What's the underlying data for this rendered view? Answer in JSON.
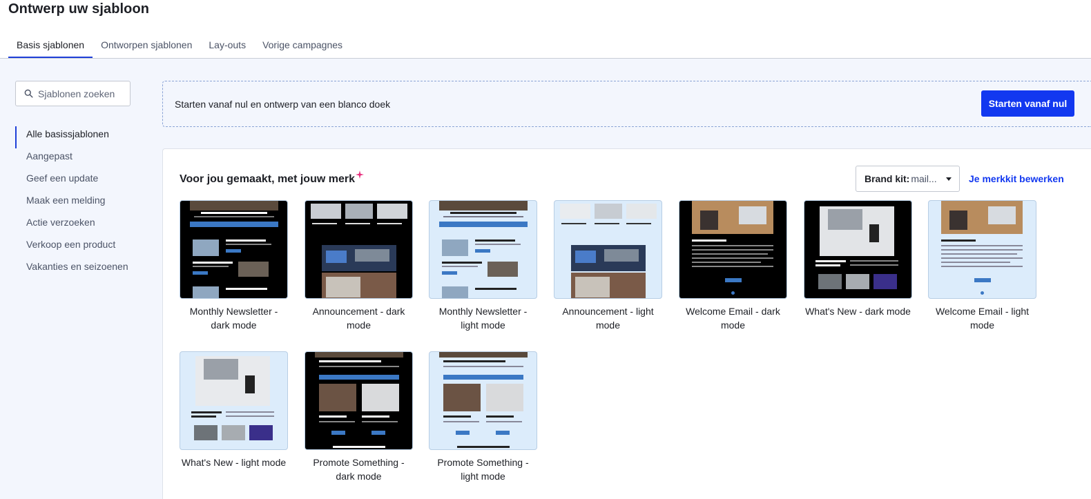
{
  "page": {
    "title": "Ontwerp uw sjabloon"
  },
  "tabs": [
    {
      "label": "Basis sjablonen",
      "active": true
    },
    {
      "label": "Ontworpen sjablonen",
      "active": false
    },
    {
      "label": "Lay-outs",
      "active": false
    },
    {
      "label": "Vorige campagnes",
      "active": false
    }
  ],
  "sidebar": {
    "search_placeholder": "Sjablonen zoeken",
    "categories": [
      {
        "label": "Alle basissjablonen",
        "active": true
      },
      {
        "label": "Aangepast"
      },
      {
        "label": "Geef een update"
      },
      {
        "label": "Maak een melding"
      },
      {
        "label": "Actie verzoeken"
      },
      {
        "label": "Verkoop een product"
      },
      {
        "label": "Vakanties en seizoenen"
      }
    ]
  },
  "blank": {
    "text": "Starten vanaf nul en ontwerp van een blanco doek",
    "button_label": "Starten vanaf nul"
  },
  "panel": {
    "title": "Voor jou gemaakt, met jouw merk",
    "brand_kit_label": "Brand kit:",
    "brand_kit_value": "mail...",
    "edit_link": "Je merkkit bewerken"
  },
  "colors": {
    "accent": "#1238f0",
    "tab_underline": "#1e3fd8",
    "sparkle": "#e8317f",
    "background": "#f3f6fd"
  },
  "templates": [
    {
      "name": "Monthly Newsletter - dark mode",
      "theme": "dark"
    },
    {
      "name": "Announcement - dark mode",
      "theme": "dark"
    },
    {
      "name": "Monthly Newsletter - light mode",
      "theme": "light"
    },
    {
      "name": "Announcement - light mode",
      "theme": "light"
    },
    {
      "name": "Welcome Email - dark mode",
      "theme": "dark"
    },
    {
      "name": "What's New - dark mode",
      "theme": "dark"
    },
    {
      "name": "Welcome Email - light mode",
      "theme": "light"
    },
    {
      "name": "What's New - light mode",
      "theme": "light"
    },
    {
      "name": "Promote Something - dark mode",
      "theme": "dark"
    },
    {
      "name": "Promote Something - light mode",
      "theme": "light"
    }
  ]
}
